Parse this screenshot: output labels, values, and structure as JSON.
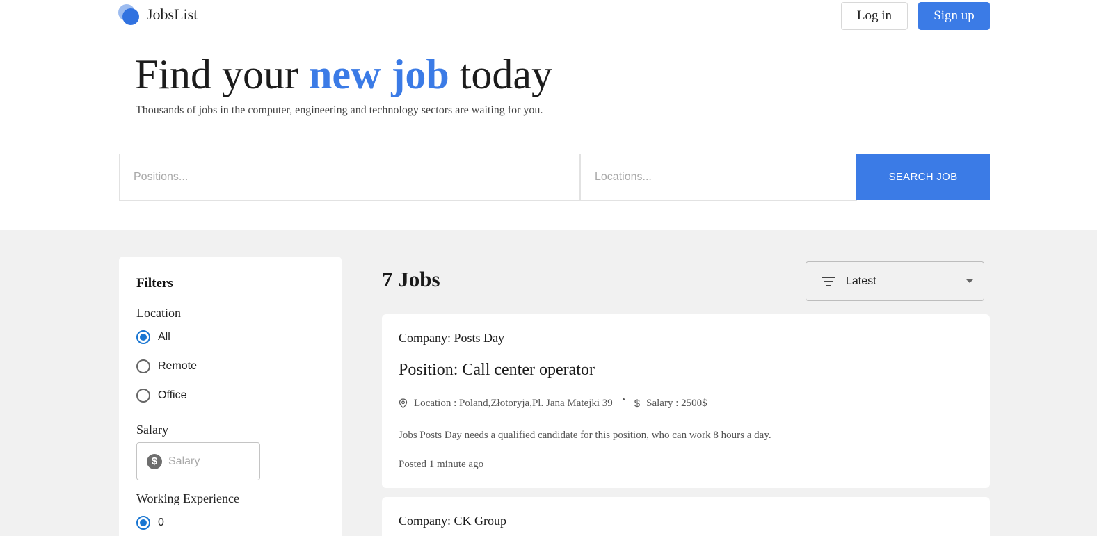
{
  "header": {
    "logo_text": "JobsList",
    "login_label": "Log in",
    "signup_label": "Sign up"
  },
  "hero": {
    "title_part1": "Find your",
    "title_accent": "new job",
    "title_part2": "today",
    "subtitle": "Thousands of jobs in the computer, engineering and technology sectors are waiting for you."
  },
  "search": {
    "positions_placeholder": "Positions...",
    "locations_placeholder": "Locations...",
    "button_label": "SEARCH JOB"
  },
  "filters": {
    "title": "Filters",
    "location_label": "Location",
    "location_options": [
      "All",
      "Remote",
      "Office"
    ],
    "location_selected": "All",
    "salary_label": "Salary",
    "salary_placeholder": "Salary",
    "salary_icon": "$",
    "experience_label": "Working Experience",
    "experience_options": [
      "0"
    ],
    "experience_selected": "0"
  },
  "jobs": {
    "count_text": "7 Jobs",
    "sort_label": "Latest",
    "items": [
      {
        "company": "Company: Posts Day",
        "position": "Position: Call center operator",
        "location": "Location : Poland,Złotoryja,Pl. Jana Matejki 39",
        "salary": "Salary : 2500$",
        "description": "Jobs Posts Day needs a qualified candidate for this position, who can work 8 hours a day.",
        "posted": "Posted 1 minute ago"
      },
      {
        "company": "Company: CK Group"
      }
    ]
  },
  "colors": {
    "accent": "#3b7be6",
    "radio_selected": "#1976d2",
    "page_gray": "#f1f1f1"
  },
  "icons": {
    "logo": "overlapping-circles-logo",
    "sort": "filter-list-icon",
    "location": "map-pin-icon",
    "salary": "dollar-icon",
    "dropdown": "caret-down-icon"
  }
}
